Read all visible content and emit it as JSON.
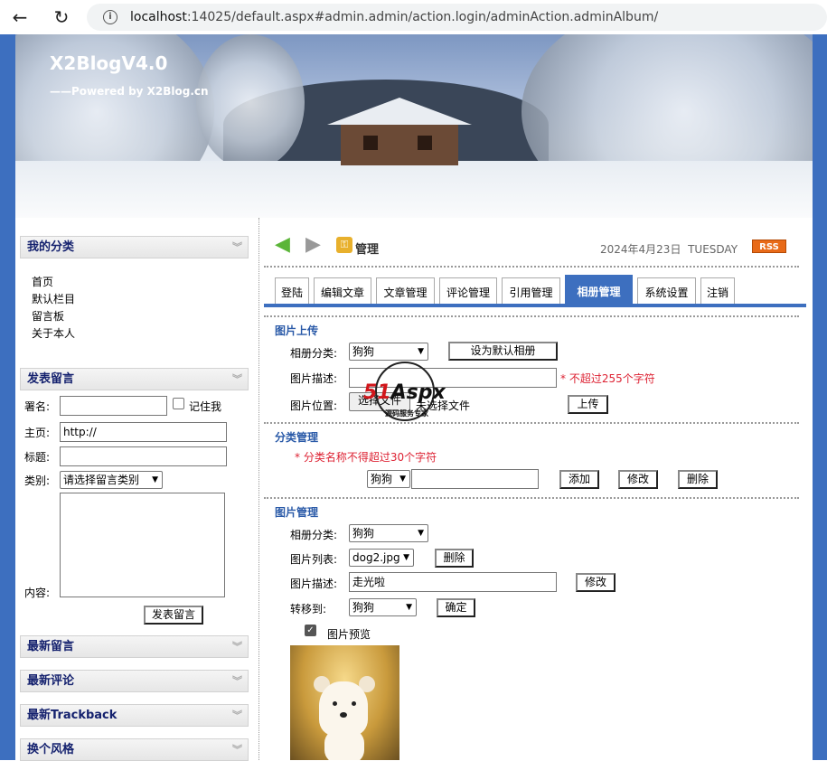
{
  "browser": {
    "url_host": "localhost",
    "url_rest": ":14025/default.aspx#admin.admin/action.login/adminAction.adminAlbum/"
  },
  "banner": {
    "title": "X2BlogV4.0",
    "subtitle": "——Powered by X2Blog.cn"
  },
  "sidebar": {
    "categories_title": "我的分类",
    "categories": [
      "首页",
      "默认栏目",
      "留言板",
      "关于本人"
    ],
    "guestbook_title": "发表留言",
    "guestbook": {
      "name_label": "署名:",
      "remember_label": "记住我",
      "homepage_label": "主页:",
      "homepage_value": "http://",
      "subject_label": "标题:",
      "type_label": "类别:",
      "type_value": "请选择留言类别",
      "content_label": "内容:",
      "submit_label": "发表留言"
    },
    "latest_messages_title": "最新留言",
    "latest_comments_title": "最新评论",
    "latest_trackback_title": "最新Trackback",
    "theme_title": "换个风格"
  },
  "toolbar": {
    "manage_label": "管理",
    "date": "2024年4月23日",
    "weekday": "TUESDAY",
    "rss_label": "RSS"
  },
  "tabs": [
    "登陆",
    "编辑文章",
    "文章管理",
    "评论管理",
    "引用管理",
    "相册管理",
    "系统设置",
    "注销"
  ],
  "upload": {
    "title": "图片上传",
    "category_label": "相册分类:",
    "category_value": "狗狗",
    "set_default_label": "设为默认相册",
    "desc_label": "图片描述:",
    "desc_hint": "* 不超过255个字符",
    "location_label": "图片位置:",
    "choose_file_label": "选择文件",
    "no_file_label": "未选择文件",
    "upload_label": "上传"
  },
  "category_mgmt": {
    "title": "分类管理",
    "hint": "* 分类名称不得超过30个字符",
    "select_value": "狗狗",
    "add_label": "添加",
    "edit_label": "修改",
    "delete_label": "删除"
  },
  "image_mgmt": {
    "title": "图片管理",
    "category_label": "相册分类:",
    "category_value": "狗狗",
    "list_label": "图片列表:",
    "list_value": "dog2.jpg",
    "delete_label": "删除",
    "desc_label": "图片描述:",
    "desc_value": "走光啦",
    "edit_label": "修改",
    "move_label": "转移到:",
    "move_value": "狗狗",
    "confirm_label": "确定",
    "preview_label": "图片预览",
    "preview_checked": true
  },
  "watermark": {
    "brand_number": "51",
    "brand_text": "Aspx",
    "tagline": "源码服务专家"
  }
}
